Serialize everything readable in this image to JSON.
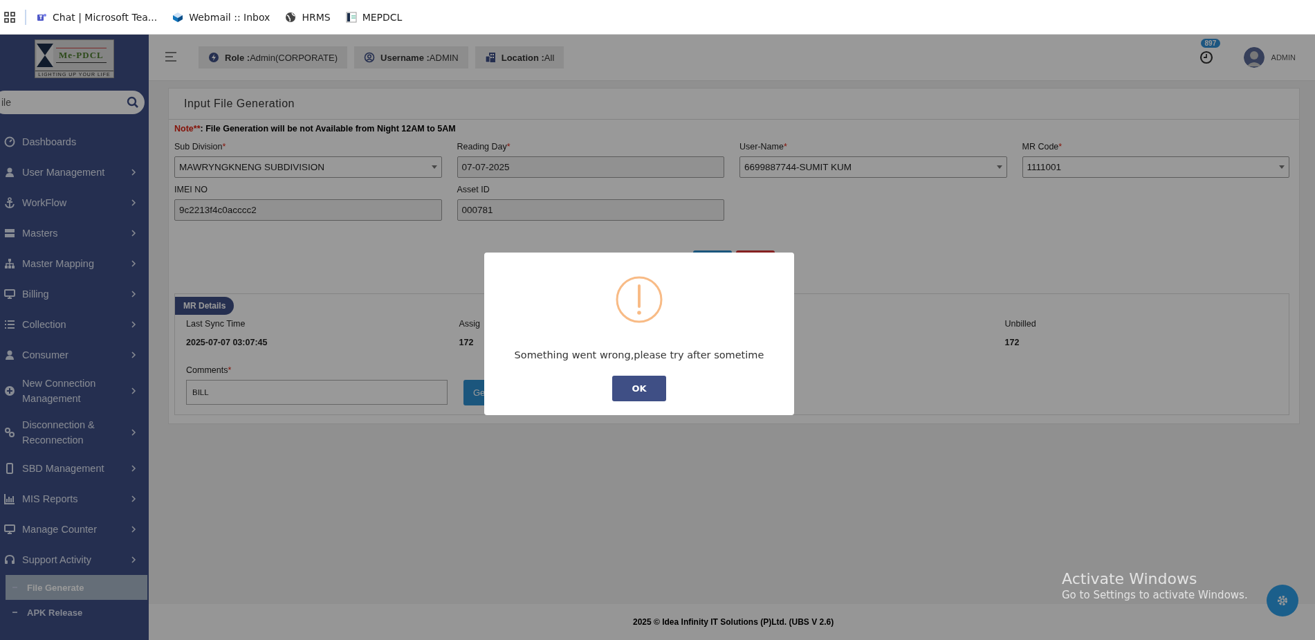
{
  "bookmarks": [
    {
      "label": "Chat | Microsoft Tea..."
    },
    {
      "label": "Webmail :: Inbox"
    },
    {
      "label": "HRMS"
    },
    {
      "label": "MEPDCL"
    }
  ],
  "logo": {
    "name": "Me-PDCL",
    "tagline": "LIGHTING UP YOUR LIFE"
  },
  "sidebar": {
    "search": {
      "placeholder": "ile"
    },
    "items": [
      {
        "label": "Dashboards",
        "kind": "link"
      },
      {
        "label": "User Management",
        "kind": "group"
      },
      {
        "label": "WorkFlow",
        "kind": "group"
      },
      {
        "label": "Masters",
        "kind": "group"
      },
      {
        "label": "Master Mapping",
        "kind": "group"
      },
      {
        "label": "Billing",
        "kind": "group"
      },
      {
        "label": "Collection",
        "kind": "group"
      },
      {
        "label": "Consumer",
        "kind": "group"
      },
      {
        "label": "New Connection Management",
        "kind": "group"
      },
      {
        "label": "Disconnection & Reconnection",
        "kind": "group"
      },
      {
        "label": "SBD Management",
        "kind": "group"
      },
      {
        "label": "MIS Reports",
        "kind": "group"
      },
      {
        "label": "Manage Counter",
        "kind": "group"
      },
      {
        "label": "Support Activity",
        "kind": "group",
        "children": [
          {
            "label": "File Generate",
            "selected": true
          },
          {
            "label": "APK Release",
            "selected": false
          }
        ]
      }
    ]
  },
  "header": {
    "info": [
      {
        "label": "Role :",
        "value": "Admin(CORPORATE)"
      },
      {
        "label": "Username :",
        "value": "ADMIN"
      },
      {
        "label": "Location :",
        "value": "All"
      }
    ],
    "notification_count": "897",
    "user": "ADMIN"
  },
  "panel": {
    "title": "Input File Generation",
    "note": {
      "label": "Note",
      "mark": "**",
      "text": ": File Generation will be not Available from Night 12AM to 5AM"
    },
    "fields": [
      {
        "label": "Sub Division",
        "mark": "*",
        "kind": "select",
        "value": "MAWRYNGKNENG SUBDIVISION"
      },
      {
        "label": "Reading Day",
        "mark": "*",
        "kind": "input",
        "value": "07-07-2025"
      },
      {
        "label": "User-Name",
        "mark": "*",
        "kind": "select",
        "value": "6699887744-SUMIT KUM"
      },
      {
        "label": "MR Code",
        "mark": "*",
        "kind": "select",
        "value": "1111001"
      },
      {
        "label": "IMEI NO",
        "kind": "input",
        "value": "9c2213f4c0acccc2"
      },
      {
        "label": "Asset ID",
        "kind": "input",
        "value": "000781"
      }
    ],
    "mr_details": {
      "title": "MR Details",
      "stats": [
        {
          "label": "Last Sync Time",
          "value": "2025-07-07 03:07:45"
        },
        {
          "label": "Assig",
          "value": "172"
        },
        {
          "label": "Unbilled",
          "value": "172"
        }
      ],
      "comments": {
        "label": "Comments",
        "mark": "*",
        "value": "BILL"
      },
      "generate_button": "Ge"
    }
  },
  "dialog": {
    "message": "Something went wrong,please try after sometime",
    "button": "OK"
  },
  "footer": "2025 © Idea Infinity IT Solutions (P)Ltd. (UBS V 2.6)",
  "os_notice": {
    "title": "Activate Windows",
    "text": "Go to Settings to activate Windows."
  }
}
